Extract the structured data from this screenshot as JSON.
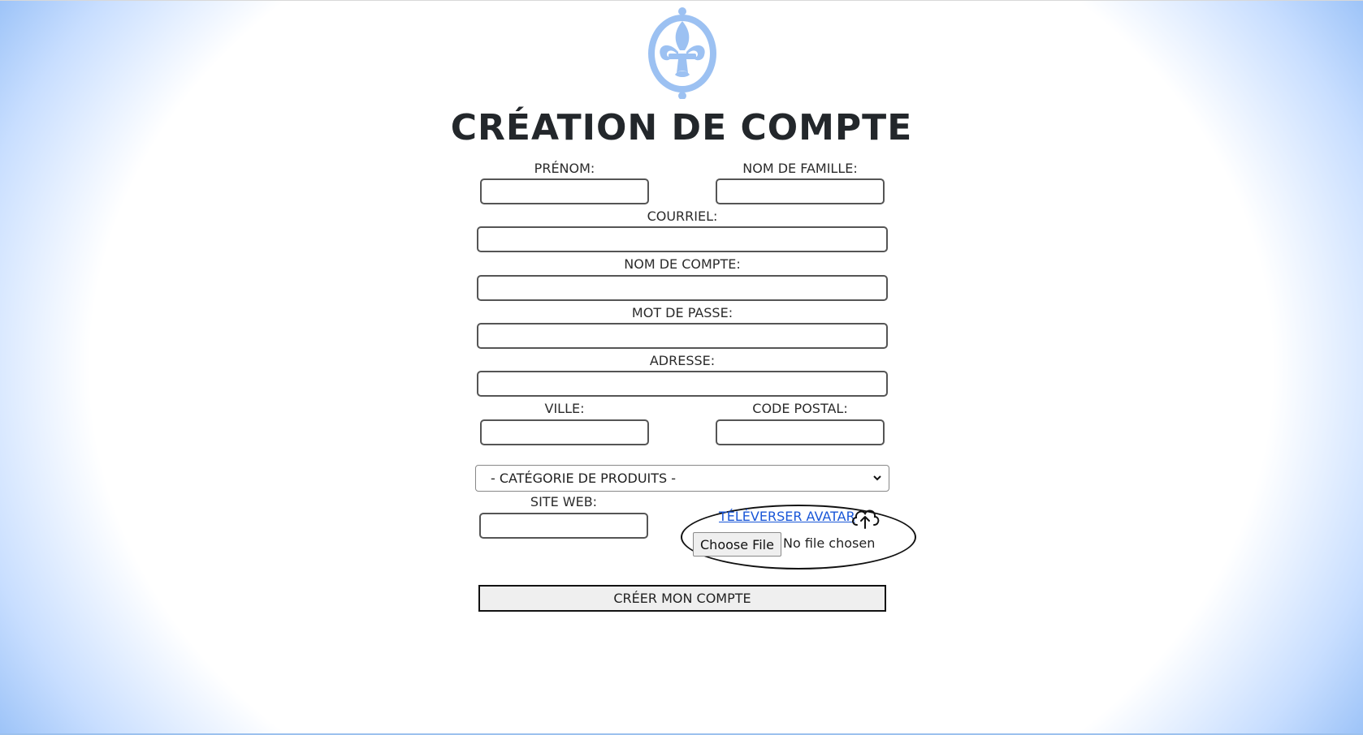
{
  "header": {
    "logo_icon": "fleur-de-lis-icon",
    "logo_color": "#9cc1f2",
    "title": "CRÉATION DE COMPTE"
  },
  "form": {
    "first_name": {
      "label": "PRÉNOM:",
      "value": ""
    },
    "last_name": {
      "label": "NOM DE FAMILLE:",
      "value": ""
    },
    "email": {
      "label": "COURRIEL:",
      "value": ""
    },
    "username": {
      "label": "NOM DE COMPTE:",
      "value": ""
    },
    "password": {
      "label": "MOT DE PASSE:",
      "value": ""
    },
    "address": {
      "label": "ADRESSE:",
      "value": ""
    },
    "city": {
      "label": "VILLE:",
      "value": ""
    },
    "postal_code": {
      "label": "CODE POSTAL:",
      "value": ""
    },
    "category": {
      "selected": "- CATÉGORIE DE PRODUITS -"
    },
    "website": {
      "label": "SITE WEB:",
      "value": ""
    },
    "avatar": {
      "link_label": "TÉLÉVERSER AVATAR",
      "upload_icon": "cloud-upload-icon",
      "file_button_label": "Choose File",
      "file_status": "No file chosen"
    },
    "submit_label": "CRÉER MON COMPTE"
  },
  "colors": {
    "link": "#1a57d8",
    "background_edge": "#8cb9f5"
  }
}
